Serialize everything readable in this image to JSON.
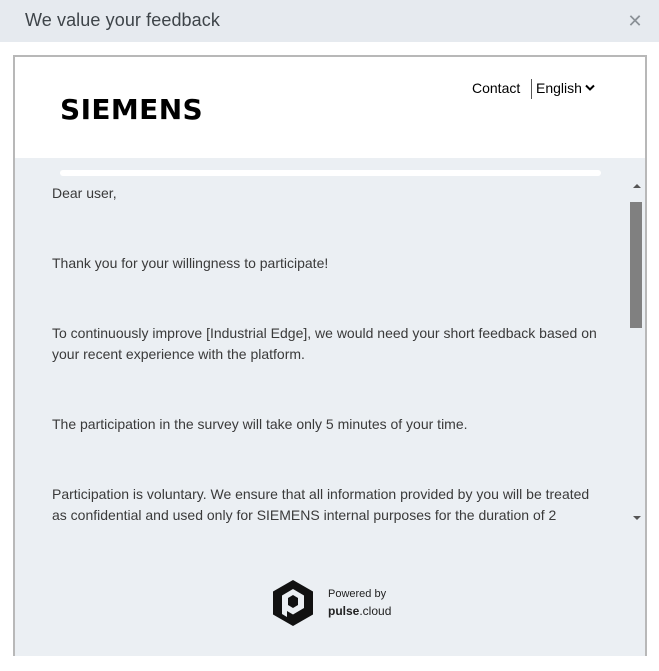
{
  "dialog": {
    "title": "We value your feedback",
    "close_glyph": "✕"
  },
  "header": {
    "brand": "SIEMENS",
    "contact_label": "Contact",
    "language_selected": "English"
  },
  "survey": {
    "progress_fraction": 0,
    "paragraphs": [
      "Dear user,",
      "Thank you for your willingness to participate!",
      "To continuously improve [Industrial Edge], we would need your short feedback based on your recent experience with the platform.",
      "The participation in the survey will take only 5 minutes of your time.",
      "Participation is voluntary. We ensure that all information provided by you will be treated as confidential and used only for SIEMENS internal purposes for the duration of 2"
    ]
  },
  "footer": {
    "powered_by": "Powered by",
    "product_bold": "pulse",
    "product_suffix": ".cloud"
  },
  "icons": {
    "close": "close-icon",
    "chevron": "chevron-down-icon",
    "scroll_up": "scroll-up-arrow-icon",
    "scroll_down": "scroll-down-arrow-icon",
    "logo": "pulse-cloud-logo-icon"
  },
  "colors": {
    "titlebar_bg": "#e6eaef",
    "content_bg": "#ebeff3",
    "text": "#3a3a3a"
  }
}
